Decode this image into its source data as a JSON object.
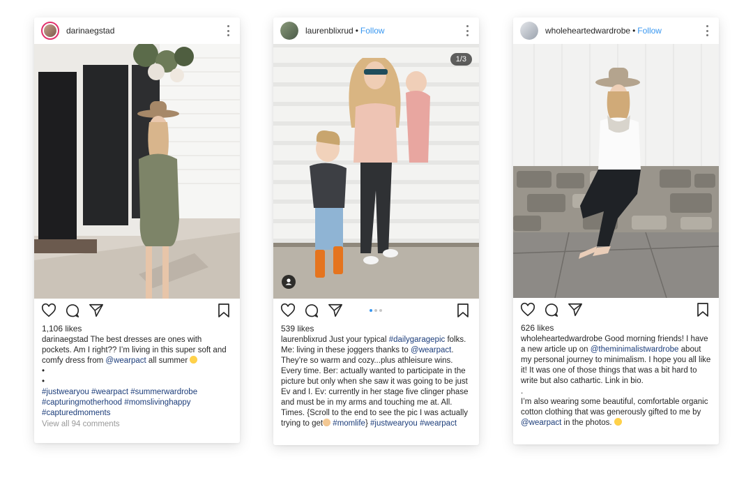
{
  "posts": [
    {
      "username": "darinaegstad",
      "follow_label": "",
      "likes": "1,106 likes",
      "caption_user": "darinaegstad",
      "caption_text": " The best dresses are ones with pockets. Am I right?? I’m living in this super soft and comfy dress from ",
      "caption_mention": "@wearpact",
      "caption_after": " all summer ",
      "caption_dots": [
        "•",
        "•"
      ],
      "hashtags": [
        "#justwearyou",
        "#wearpact",
        "#summerwardrobe",
        "#capturingmotherhood",
        "#momslivinghappy",
        "#capturedmoments"
      ],
      "comments_label": "View all 94 comments"
    },
    {
      "username": "laurenblixrud",
      "follow_label": "Follow",
      "counter": "1/3",
      "likes": "539 likes",
      "caption_user": "laurenblixrud",
      "caption_text": " Just your typical ",
      "caption_tag1": "#dailygaragepic",
      "caption_text2": " folks. Me: living in these joggers thanks to ",
      "caption_mention": "@wearpact",
      "caption_text3": ". They’re so warm and cozy...plus athleisure wins. Every time. Ber: actually wanted to participate in the picture but only when she saw it was going to be just Ev and I. Ev: currently in her stage five clinger phase and must be in my arms and touching me at. All. Times. {Scroll to the end to see the pic I was actually trying to get",
      "caption_tags_end": [
        "#momlife"
      ],
      "caption_brace": "} ",
      "caption_tags_after": [
        "#justwearyou",
        "#wearpact"
      ]
    },
    {
      "username": "wholeheartedwardrobe",
      "follow_label": "Follow",
      "likes": "626 likes",
      "caption_user": "wholeheartedwardrobe",
      "caption_text": " Good morning friends! I have a new article up on ",
      "caption_mention": "@theminimalistwardrobe",
      "caption_text2": " about my personal journey to minimalism. I hope you all like it! It was one of those things that was a bit hard to write but also cathartic. Link in bio.",
      "caption_dot": ".",
      "caption_text3": "I’m also wearing some beautiful, comfortable organic cotton clothing that was generously gifted to me by ",
      "caption_mention2": "@wearpact",
      "caption_text4": " in the photos. "
    }
  ],
  "separator": "•",
  "icons": [
    "heart-icon",
    "comment-icon",
    "share-icon",
    "save-icon",
    "more-icon",
    "user-tag-icon"
  ],
  "colors": {
    "link": "#3897f0",
    "hashtag": "#1c3d7a",
    "muted": "#999999",
    "story_ring": "#e1306c"
  }
}
